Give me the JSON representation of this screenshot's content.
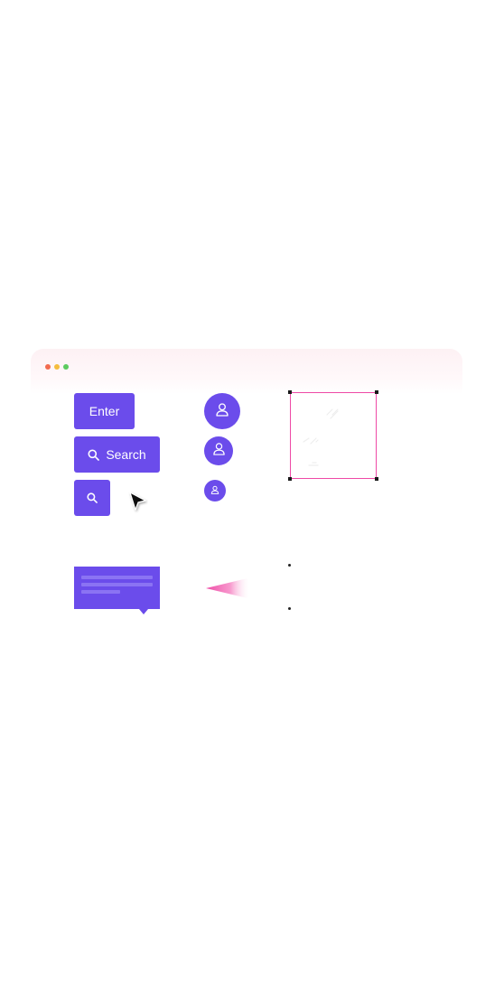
{
  "colors": {
    "accent": "#6b4ceb",
    "traffic_close": "#f26b4f",
    "traffic_minimize": "#f5bd3e",
    "traffic_maximize": "#5ccb5f",
    "selection_border": "#ee4aa6"
  },
  "buttons": {
    "enter_label": "Enter",
    "search_label": "Search"
  },
  "icons": {
    "search": "search-icon",
    "user": "user-icon",
    "cursor": "cursor-arrow-icon"
  }
}
